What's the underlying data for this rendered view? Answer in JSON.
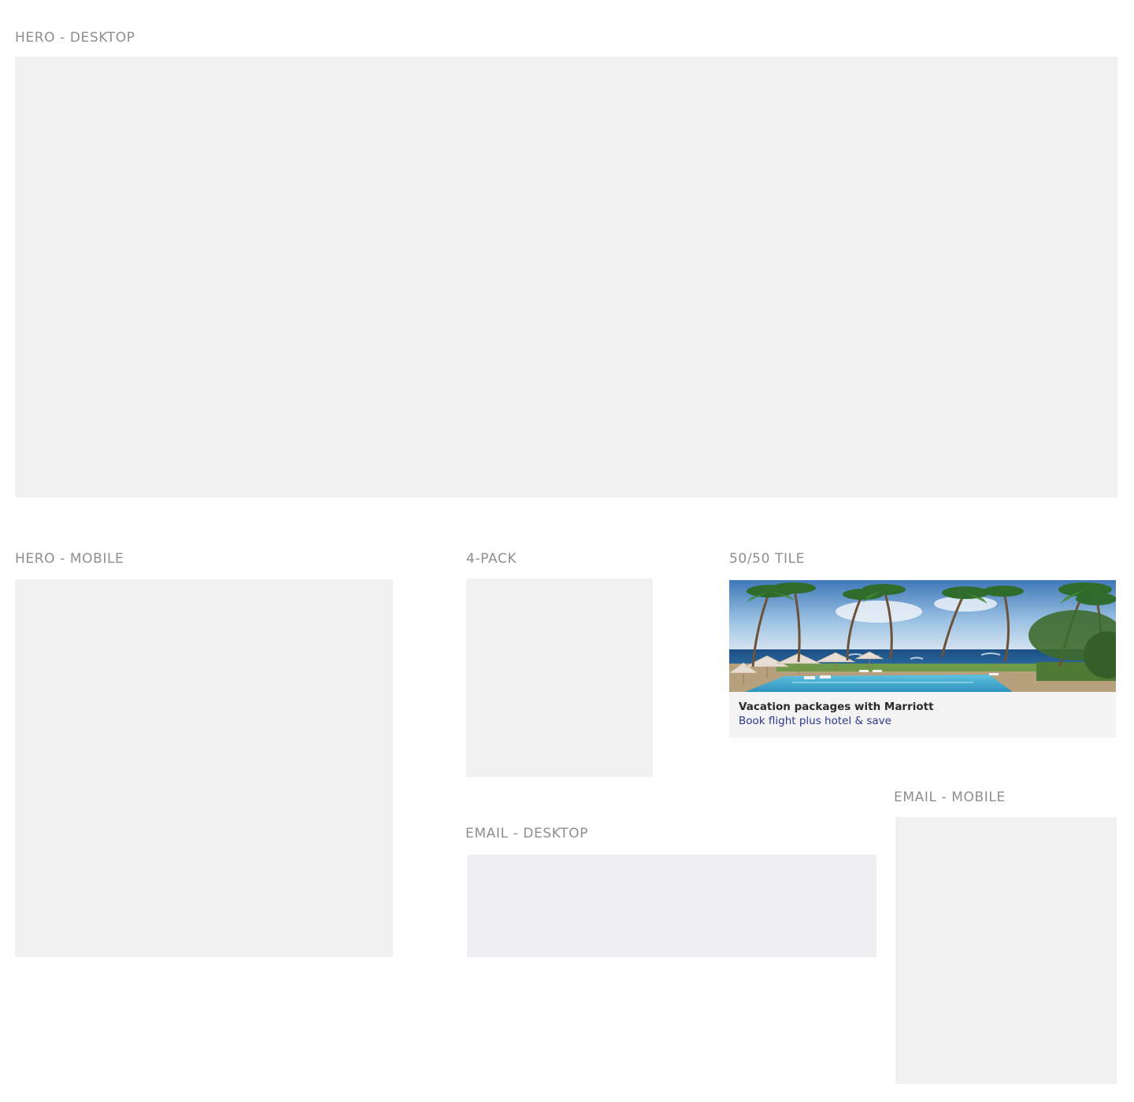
{
  "sections": {
    "hero_desktop": {
      "label": "HERO - DESKTOP"
    },
    "hero_mobile": {
      "label": "HERO - MOBILE"
    },
    "four_pack": {
      "label": "4-PACK"
    },
    "fifty_tile": {
      "label": "50/50 TILE",
      "title": "Vacation packages with Marriott",
      "link": "Book flight plus hotel & save"
    },
    "email_desktop": {
      "label": "EMAIL - DESKTOP"
    },
    "email_mobile": {
      "label": "EMAIL - MOBILE"
    }
  },
  "colors": {
    "label_gray": "#8e8e8e",
    "placeholder_gray": "#f1f1f1",
    "link_blue": "#2b3a8c"
  }
}
